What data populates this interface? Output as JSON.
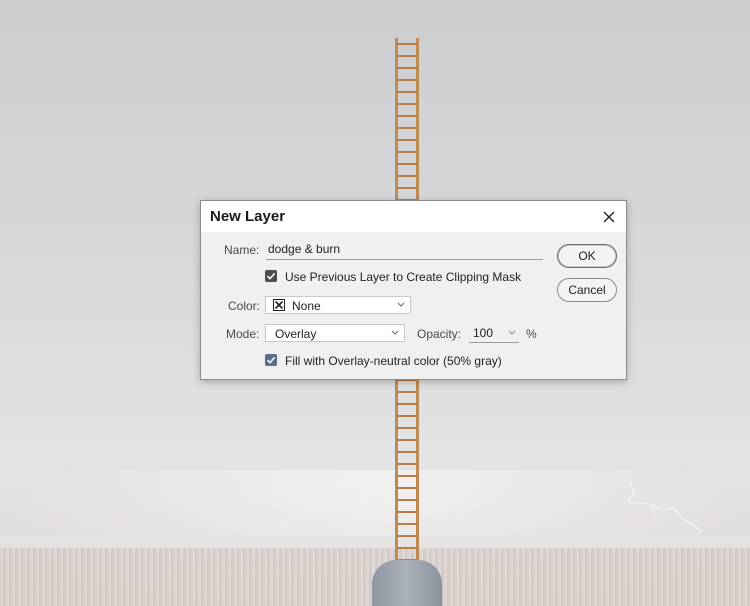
{
  "dialog": {
    "title": "New Layer",
    "name_label": "Name:",
    "name_value": "dodge & burn",
    "clip_checkbox_label": "Use Previous Layer to Create Clipping Mask",
    "clip_checked": true,
    "color_label": "Color:",
    "color_value": "None",
    "mode_label": "Mode:",
    "mode_value": "Overlay",
    "opacity_label": "Opacity:",
    "opacity_value": "100",
    "opacity_unit": "%",
    "fill_checkbox_label": "Fill with Overlay-neutral color (50% gray)",
    "fill_checked": true,
    "ok_label": "OK",
    "cancel_label": "Cancel"
  },
  "icons": {
    "close": "close-icon",
    "check": "checkmark-icon",
    "chevron": "chevron-down-icon",
    "color_none": "color-none-icon"
  },
  "colors": {
    "dialog_bg": "#f0f0f0",
    "titlebar_bg": "#ffffff",
    "checkbox_dark": "#4d4d4d",
    "checkbox_blue": "#5a6e8c"
  }
}
